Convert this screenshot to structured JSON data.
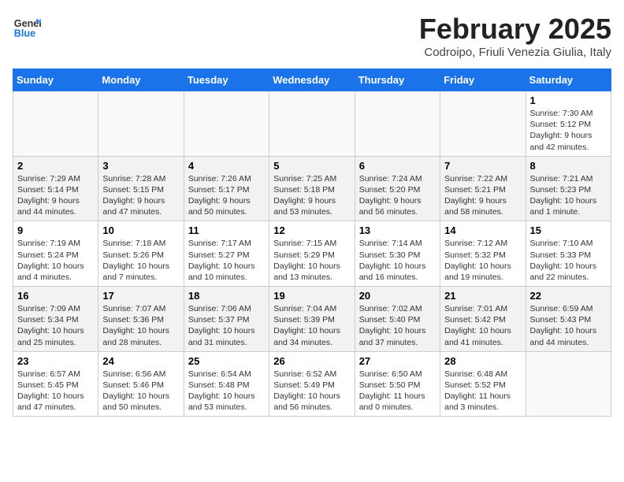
{
  "logo": {
    "line1": "General",
    "line2": "Blue"
  },
  "title": "February 2025",
  "location": "Codroipo, Friuli Venezia Giulia, Italy",
  "days_of_week": [
    "Sunday",
    "Monday",
    "Tuesday",
    "Wednesday",
    "Thursday",
    "Friday",
    "Saturday"
  ],
  "weeks": [
    [
      {
        "day": "",
        "info": ""
      },
      {
        "day": "",
        "info": ""
      },
      {
        "day": "",
        "info": ""
      },
      {
        "day": "",
        "info": ""
      },
      {
        "day": "",
        "info": ""
      },
      {
        "day": "",
        "info": ""
      },
      {
        "day": "1",
        "info": "Sunrise: 7:30 AM\nSunset: 5:12 PM\nDaylight: 9 hours and 42 minutes."
      }
    ],
    [
      {
        "day": "2",
        "info": "Sunrise: 7:29 AM\nSunset: 5:14 PM\nDaylight: 9 hours and 44 minutes."
      },
      {
        "day": "3",
        "info": "Sunrise: 7:28 AM\nSunset: 5:15 PM\nDaylight: 9 hours and 47 minutes."
      },
      {
        "day": "4",
        "info": "Sunrise: 7:26 AM\nSunset: 5:17 PM\nDaylight: 9 hours and 50 minutes."
      },
      {
        "day": "5",
        "info": "Sunrise: 7:25 AM\nSunset: 5:18 PM\nDaylight: 9 hours and 53 minutes."
      },
      {
        "day": "6",
        "info": "Sunrise: 7:24 AM\nSunset: 5:20 PM\nDaylight: 9 hours and 56 minutes."
      },
      {
        "day": "7",
        "info": "Sunrise: 7:22 AM\nSunset: 5:21 PM\nDaylight: 9 hours and 58 minutes."
      },
      {
        "day": "8",
        "info": "Sunrise: 7:21 AM\nSunset: 5:23 PM\nDaylight: 10 hours and 1 minute."
      }
    ],
    [
      {
        "day": "9",
        "info": "Sunrise: 7:19 AM\nSunset: 5:24 PM\nDaylight: 10 hours and 4 minutes."
      },
      {
        "day": "10",
        "info": "Sunrise: 7:18 AM\nSunset: 5:26 PM\nDaylight: 10 hours and 7 minutes."
      },
      {
        "day": "11",
        "info": "Sunrise: 7:17 AM\nSunset: 5:27 PM\nDaylight: 10 hours and 10 minutes."
      },
      {
        "day": "12",
        "info": "Sunrise: 7:15 AM\nSunset: 5:29 PM\nDaylight: 10 hours and 13 minutes."
      },
      {
        "day": "13",
        "info": "Sunrise: 7:14 AM\nSunset: 5:30 PM\nDaylight: 10 hours and 16 minutes."
      },
      {
        "day": "14",
        "info": "Sunrise: 7:12 AM\nSunset: 5:32 PM\nDaylight: 10 hours and 19 minutes."
      },
      {
        "day": "15",
        "info": "Sunrise: 7:10 AM\nSunset: 5:33 PM\nDaylight: 10 hours and 22 minutes."
      }
    ],
    [
      {
        "day": "16",
        "info": "Sunrise: 7:09 AM\nSunset: 5:34 PM\nDaylight: 10 hours and 25 minutes."
      },
      {
        "day": "17",
        "info": "Sunrise: 7:07 AM\nSunset: 5:36 PM\nDaylight: 10 hours and 28 minutes."
      },
      {
        "day": "18",
        "info": "Sunrise: 7:06 AM\nSunset: 5:37 PM\nDaylight: 10 hours and 31 minutes."
      },
      {
        "day": "19",
        "info": "Sunrise: 7:04 AM\nSunset: 5:39 PM\nDaylight: 10 hours and 34 minutes."
      },
      {
        "day": "20",
        "info": "Sunrise: 7:02 AM\nSunset: 5:40 PM\nDaylight: 10 hours and 37 minutes."
      },
      {
        "day": "21",
        "info": "Sunrise: 7:01 AM\nSunset: 5:42 PM\nDaylight: 10 hours and 41 minutes."
      },
      {
        "day": "22",
        "info": "Sunrise: 6:59 AM\nSunset: 5:43 PM\nDaylight: 10 hours and 44 minutes."
      }
    ],
    [
      {
        "day": "23",
        "info": "Sunrise: 6:57 AM\nSunset: 5:45 PM\nDaylight: 10 hours and 47 minutes."
      },
      {
        "day": "24",
        "info": "Sunrise: 6:56 AM\nSunset: 5:46 PM\nDaylight: 10 hours and 50 minutes."
      },
      {
        "day": "25",
        "info": "Sunrise: 6:54 AM\nSunset: 5:48 PM\nDaylight: 10 hours and 53 minutes."
      },
      {
        "day": "26",
        "info": "Sunrise: 6:52 AM\nSunset: 5:49 PM\nDaylight: 10 hours and 56 minutes."
      },
      {
        "day": "27",
        "info": "Sunrise: 6:50 AM\nSunset: 5:50 PM\nDaylight: 11 hours and 0 minutes."
      },
      {
        "day": "28",
        "info": "Sunrise: 6:48 AM\nSunset: 5:52 PM\nDaylight: 11 hours and 3 minutes."
      },
      {
        "day": "",
        "info": ""
      }
    ]
  ]
}
